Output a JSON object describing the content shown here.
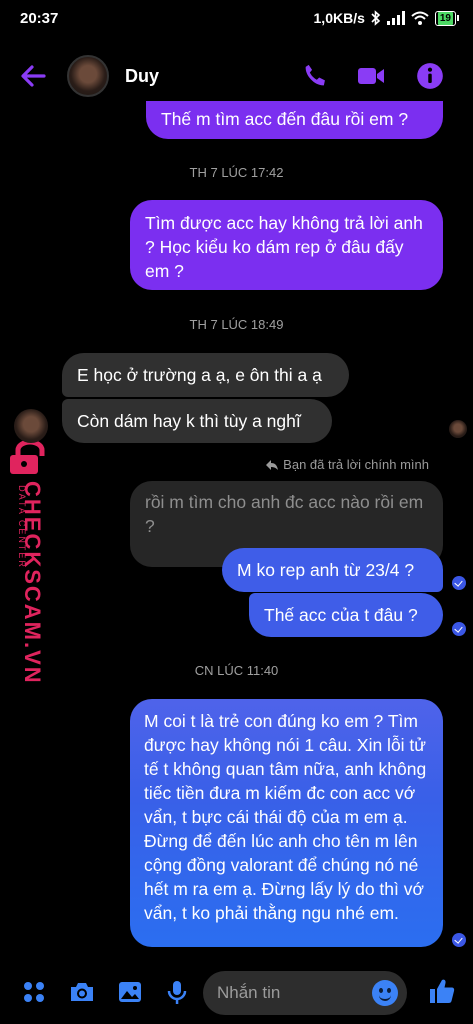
{
  "status_bar": {
    "time": "20:37",
    "network_speed": "1,0KB/s",
    "battery": "19"
  },
  "header": {
    "contact_name": "Duy"
  },
  "messages": [
    {
      "text": "Thế m tìm acc đến đâu rồi em ?"
    },
    {
      "timestamp": "TH 7 LÚC 17:42"
    },
    {
      "text": "Tìm được acc hay không trả lời anh ? Học kiểu ko dám rep ở đâu đấy em ?"
    },
    {
      "timestamp": "TH 7 LÚC 18:49"
    },
    {
      "text": "E học ở trường a ạ, e ôn thi a ạ"
    },
    {
      "text": "Còn dám hay k thì tùy a nghĩ"
    },
    {
      "reply_note": "Bạn đã trả lời chính mình"
    },
    {
      "text": "rồi m tìm cho anh đc acc nào rồi em ?"
    },
    {
      "text": "M ko rep anh từ 23/4 ?"
    },
    {
      "text": "Thế acc của t đâu ?"
    },
    {
      "timestamp": "CN LÚC 11:40"
    },
    {
      "text": "M coi t là trẻ con đúng ko em ? Tìm được hay không nói 1 câu. Xin lỗi tử tế t không quan tâm nữa, anh không tiếc tiền đưa m kiếm đc con acc vớ vẩn, t bực cái thái độ của m em ạ. Đừng để đến lúc anh cho tên m lên cộng đồng valorant để chúng nó né hết m ra em ạ. Đừng lấy lý do thì vớ vẩn, t ko phải thằng ngu nhé em."
    }
  ],
  "watermark": {
    "brand": "CHECKSCAM.VN",
    "tagline": "DATA CENTER"
  },
  "composer": {
    "placeholder": "Nhắn tin"
  },
  "colors": {
    "accent": "#8a3cf5",
    "outgoing_purple": "#7b2ff0",
    "outgoing_blue": "#3f5de8",
    "incoming": "#303030",
    "watermark": "#e0245e"
  }
}
